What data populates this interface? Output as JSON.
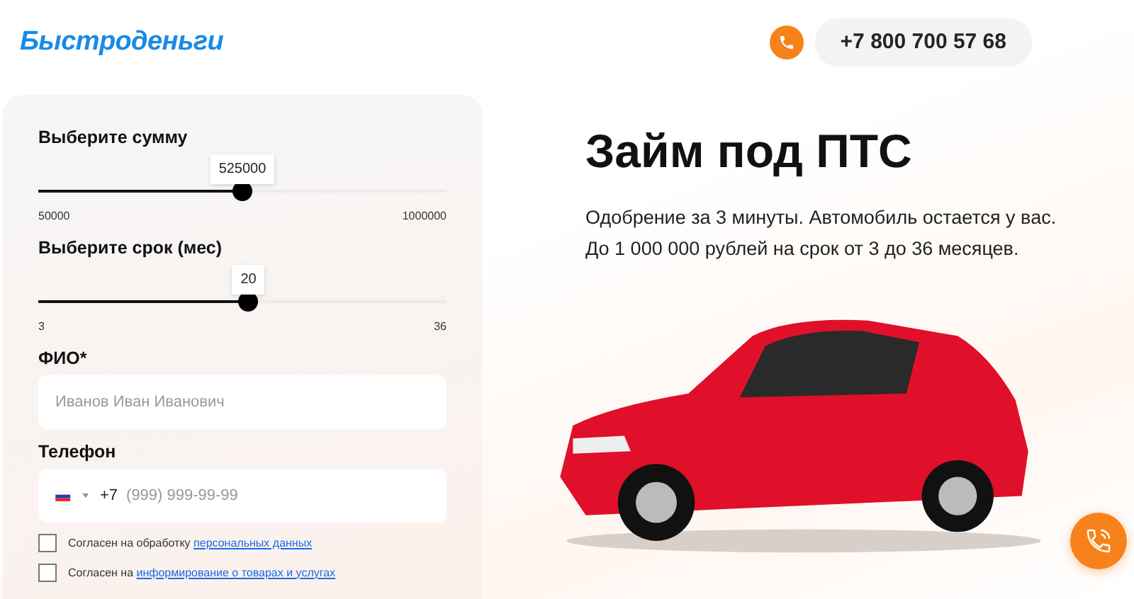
{
  "header": {
    "logo": "Быстроденьги",
    "phone": "+7 800 700 57 68"
  },
  "form": {
    "sliders": [
      {
        "label": "Выберите сумму",
        "value": "525000",
        "level": 0.5,
        "min": "50000",
        "max": "1000000"
      },
      {
        "label": "Выберите срок (мес)",
        "value": "20",
        "level": 0.515,
        "min": "3",
        "max": "36"
      }
    ],
    "name_field": {
      "label": "ФИО*",
      "placeholder": "Иванов Иван Иванович"
    },
    "phone_field": {
      "label": "Телефон",
      "prefix": "+7",
      "placeholder": "(999) 999-99-99"
    },
    "consents": [
      {
        "text": "Согласен на обработку ",
        "link": "персональных данных",
        "checked": false
      },
      {
        "text": "Согласен на ",
        "link": "информирование о товарах и услугах",
        "checked": false
      }
    ]
  },
  "hero": {
    "title": "Займ под ПТС",
    "lines": [
      "Одобрение за 3 минуты. Автомобиль остается у вас.",
      "До 1 000 000 рублей на срок от 3 до 36 месяцев."
    ]
  }
}
